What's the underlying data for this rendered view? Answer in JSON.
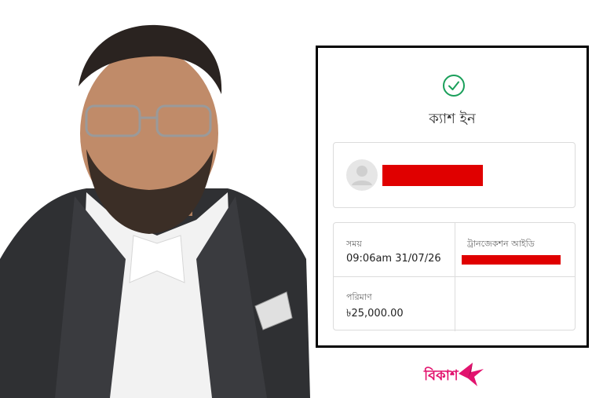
{
  "receipt": {
    "title": "ক্যাশ ইন",
    "time_label": "সময়",
    "time_value": "09:06am 31/07/26",
    "trx_label": "ট্রানজেকশন আইডি",
    "amount_label": "পরিমাণ",
    "amount_value": "৳25,000.00"
  },
  "brand": {
    "logo_text": "বিকাশ",
    "color": "#e2136e"
  },
  "icons": {
    "success": "check-circle-icon",
    "user": "user-avatar-icon",
    "logo": "bird-icon"
  }
}
